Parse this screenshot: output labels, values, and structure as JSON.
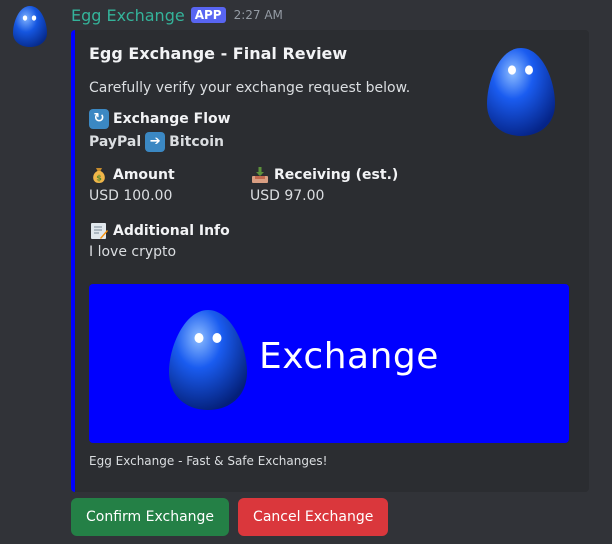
{
  "message": {
    "username": "Egg Exchange",
    "badge": "APP",
    "timestamp": "2:27 AM"
  },
  "embed": {
    "accent_color": "#0000ff",
    "title": "Egg Exchange - Final Review",
    "description": "Carefully verify your exchange request below.",
    "flow": {
      "icon": "cycle-arrows-icon",
      "name": "Exchange Flow",
      "from": "PayPal",
      "arrow_icon": "right-arrow-icon",
      "to": "Bitcoin"
    },
    "amount": {
      "icon": "money-bag-icon",
      "name": "Amount",
      "value": "USD 100.00"
    },
    "receiving": {
      "icon": "inbox-tray-icon",
      "name": "Receiving (est.)",
      "value": "USD 97.00"
    },
    "info": {
      "icon": "memo-icon",
      "name": "Additional Info",
      "value": "I love crypto"
    },
    "banner": {
      "background": "#0000ff",
      "text": "Exchange"
    },
    "footer": "Egg Exchange - Fast & Safe Exchanges!"
  },
  "actions": {
    "confirm_label": "Confirm Exchange",
    "confirm_color": "#248046",
    "cancel_label": "Cancel Exchange",
    "cancel_color": "#da373c"
  }
}
